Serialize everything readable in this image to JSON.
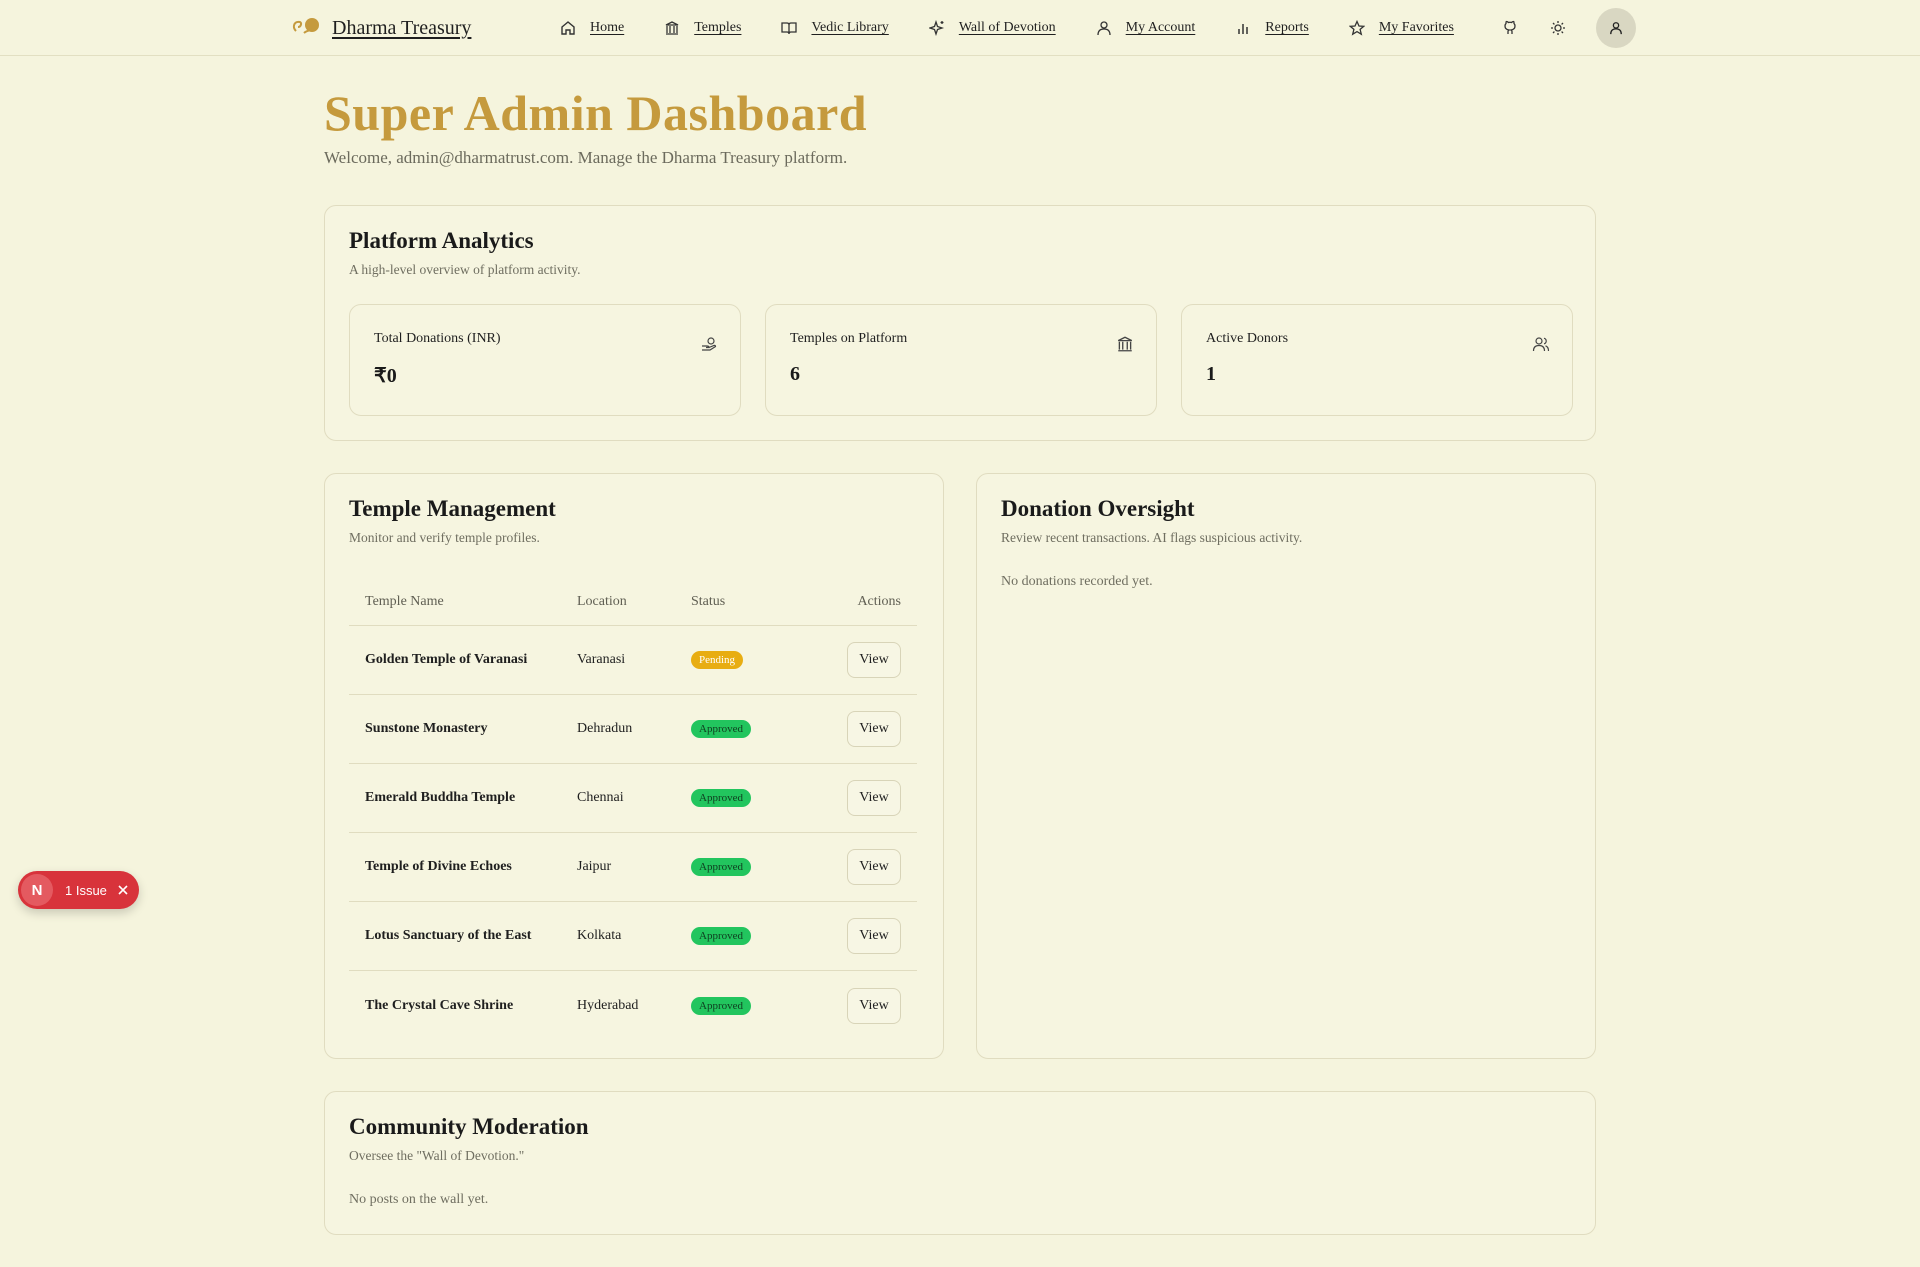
{
  "brand": {
    "name": "Dharma Treasury"
  },
  "nav": {
    "items": [
      {
        "label": "Home",
        "icon": "home-icon"
      },
      {
        "label": "Temples",
        "icon": "temple-icon"
      },
      {
        "label": "Vedic Library",
        "icon": "book-icon"
      },
      {
        "label": "Wall of Devotion",
        "icon": "sparkles-icon"
      },
      {
        "label": "My Account",
        "icon": "user-icon"
      },
      {
        "label": "Reports",
        "icon": "bar-chart-icon"
      },
      {
        "label": "My Favorites",
        "icon": "star-icon"
      }
    ],
    "tools": [
      "github-icon",
      "sun-icon",
      "user-avatar-icon"
    ]
  },
  "header": {
    "title": "Super Admin Dashboard",
    "subtitle": "Welcome, admin@dharmatrust.com. Manage the Dharma Treasury platform."
  },
  "analytics": {
    "title": "Platform Analytics",
    "subtitle": "A high-level overview of platform activity.",
    "stats": [
      {
        "label": "Total Donations (INR)",
        "value": "₹0",
        "icon": "hand-coins-icon"
      },
      {
        "label": "Temples on Platform",
        "value": "6",
        "icon": "temple-icon"
      },
      {
        "label": "Active Donors",
        "value": "1",
        "icon": "users-icon"
      }
    ]
  },
  "temples": {
    "title": "Temple Management",
    "subtitle": "Monitor and verify temple profiles.",
    "columns": [
      "Temple Name",
      "Location",
      "Status",
      "Actions"
    ],
    "rows": [
      {
        "name": "Golden Temple of Varanasi",
        "location": "Varanasi",
        "status": "Pending",
        "action": "View"
      },
      {
        "name": "Sunstone Monastery",
        "location": "Dehradun",
        "status": "Approved",
        "action": "View"
      },
      {
        "name": "Emerald Buddha Temple",
        "location": "Chennai",
        "status": "Approved",
        "action": "View"
      },
      {
        "name": "Temple of Divine Echoes",
        "location": "Jaipur",
        "status": "Approved",
        "action": "View"
      },
      {
        "name": "Lotus Sanctuary of the East",
        "location": "Kolkata",
        "status": "Approved",
        "action": "View"
      },
      {
        "name": "The Crystal Cave Shrine",
        "location": "Hyderabad",
        "status": "Approved",
        "action": "View"
      }
    ]
  },
  "donations": {
    "title": "Donation Oversight",
    "subtitle": "Review recent transactions. AI flags suspicious activity.",
    "empty": "No donations recorded yet."
  },
  "community": {
    "title": "Community Moderation",
    "subtitle": "Oversee the \"Wall of Devotion.\"",
    "empty": "No posts on the wall yet."
  },
  "issue": {
    "initial": "N",
    "label": "1 Issue"
  },
  "colors": {
    "accent": "#c59a3d",
    "pending": "#e8ad12",
    "approved": "#22c55e",
    "issue": "#d8333b"
  }
}
